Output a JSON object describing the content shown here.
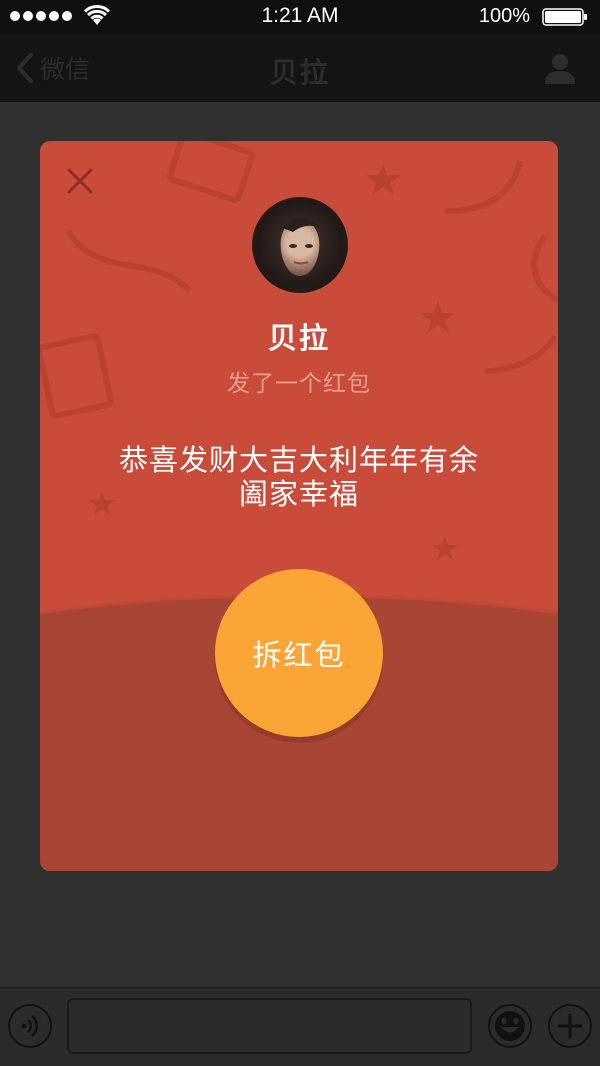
{
  "status_bar": {
    "time": "1:21 AM",
    "battery_percent": "100%",
    "signal_bars": 5
  },
  "nav": {
    "back_label": "微信",
    "title": "贝拉"
  },
  "red_packet": {
    "sender_name": "贝拉",
    "subtitle": "发了一个红包",
    "greeting_line1": "恭喜发财大吉大利年年有余",
    "greeting_line2": "阖家幸福",
    "open_button_label": "拆红包"
  },
  "colors": {
    "card": "#c84c39",
    "card_lower": "#a84534",
    "open_button": "#fca537"
  },
  "icons": {
    "close": "close-icon",
    "profile": "person-icon",
    "voice": "voice-icon",
    "emoji": "emoji-icon",
    "plus": "plus-icon"
  }
}
